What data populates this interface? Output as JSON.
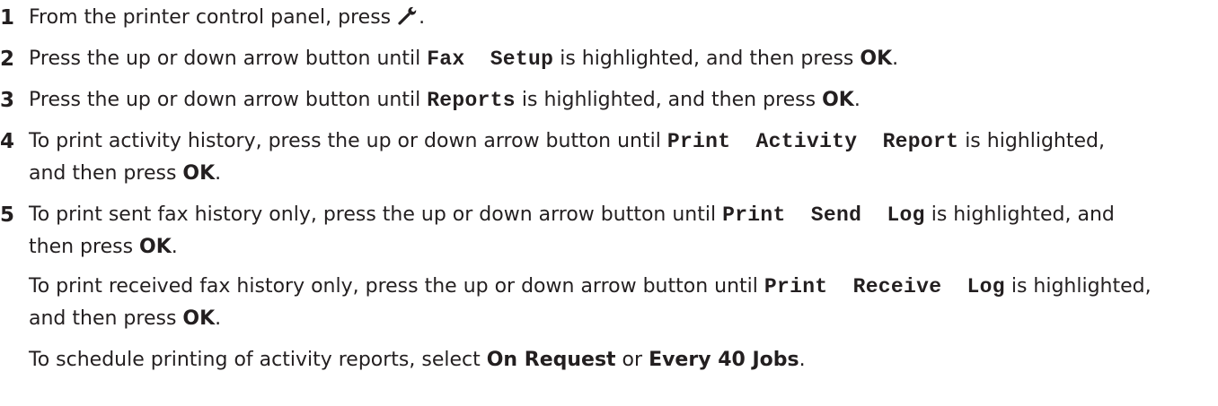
{
  "steps": [
    {
      "number": "1",
      "pre": "From the printer control panel, press ",
      "icon": "wrench-icon",
      "post": "."
    },
    {
      "number": "2",
      "pre": "Press the up or down arrow button until ",
      "code": "Fax  Setup",
      "mid": " is highlighted, and then press ",
      "bold": "OK",
      "post": "."
    },
    {
      "number": "3",
      "pre": "Press the up or down arrow button until ",
      "code": "Reports",
      "mid": " is highlighted, and then press ",
      "bold": "OK",
      "post": "."
    },
    {
      "number": "4",
      "pre": "To print activity history, press the up or down arrow button until ",
      "code": "Print  Activity  Report",
      "mid": " is highlighted,",
      "line2_pre": "and then press ",
      "bold": "OK",
      "post": "."
    },
    {
      "number": "5",
      "pre": "To print sent fax history only, press the up or down arrow button until ",
      "code": "Print  Send  Log",
      "mid": " is highlighted, and",
      "line2_pre": "then press ",
      "bold": "OK",
      "post": "."
    }
  ],
  "step5_extra": [
    {
      "pre": "To print received fax history only, press the up or down arrow button until ",
      "code": "Print  Receive  Log",
      "mid": " is highlighted,",
      "line2_pre": "and then press ",
      "bold": "OK",
      "post": "."
    },
    {
      "pre": "To schedule printing of activity reports, select ",
      "bold1": "On Request",
      "mid": " or ",
      "bold2": "Every 40 Jobs",
      "post": "."
    }
  ]
}
